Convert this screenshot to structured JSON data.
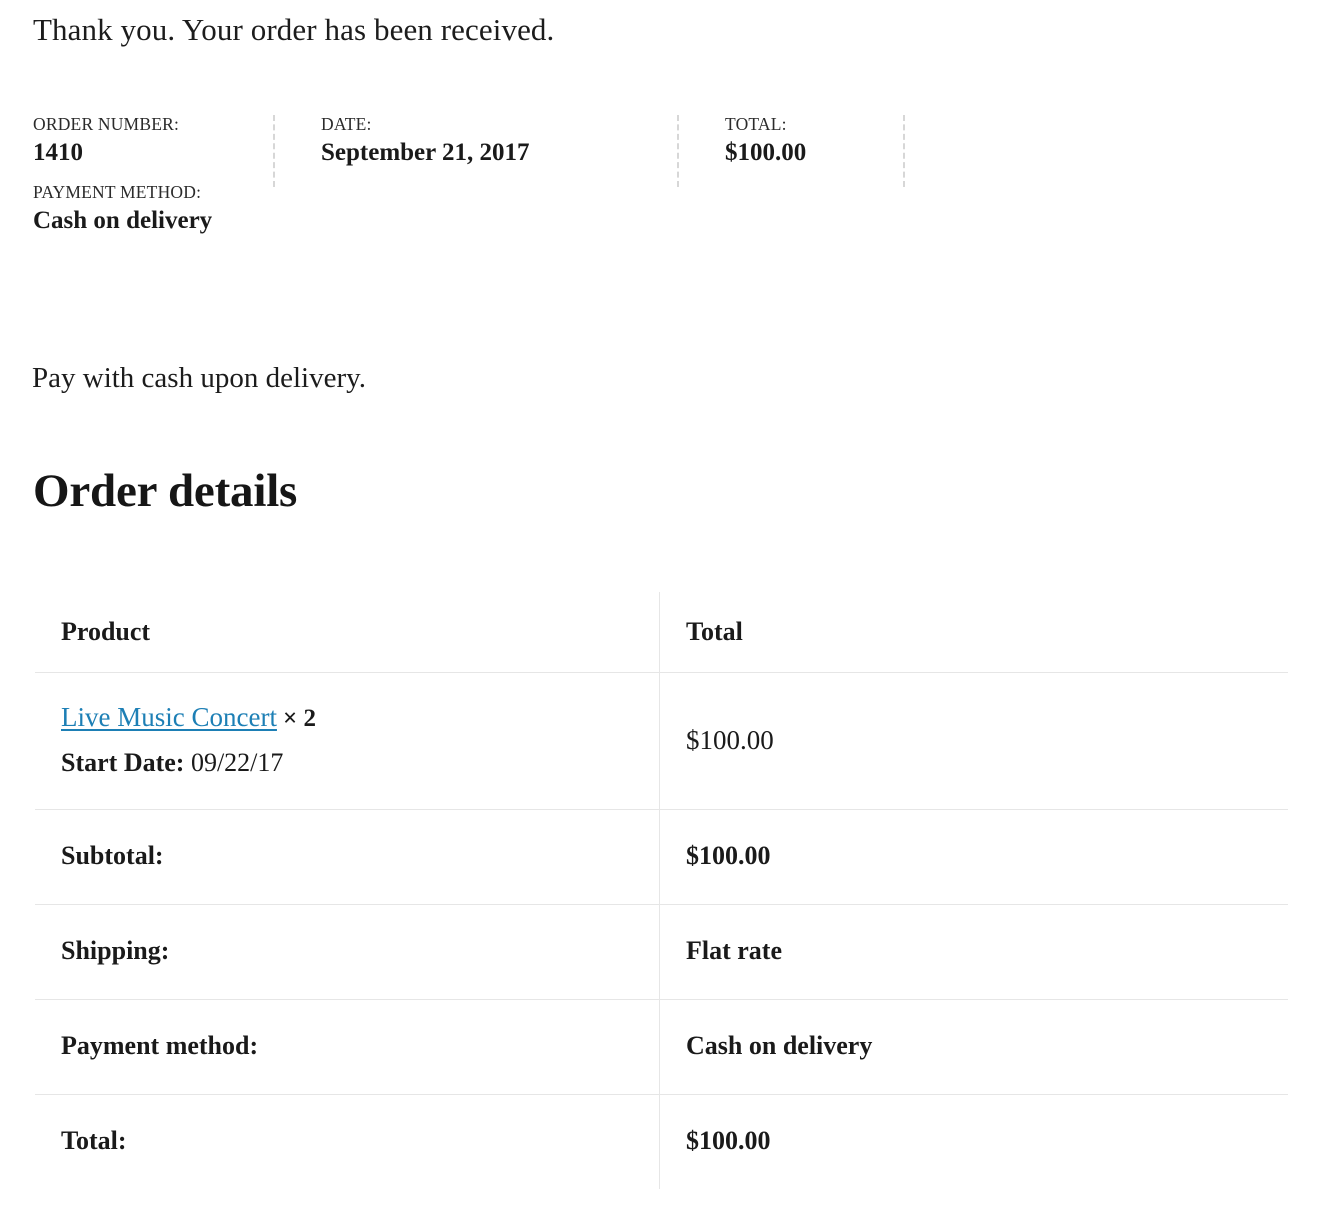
{
  "confirmation": {
    "message": "Thank you. Your order has been received."
  },
  "order_overview": {
    "order_number": {
      "label": "Order number:",
      "value": "1410"
    },
    "date": {
      "label": "Date:",
      "value": "September 21, 2017"
    },
    "total": {
      "label": "Total:",
      "value": "$100.00"
    },
    "payment_method": {
      "label": "Payment method:",
      "value": "Cash on delivery"
    }
  },
  "payment_instruction": "Pay with cash upon delivery.",
  "order_details": {
    "heading": "Order details",
    "columns": [
      "Product",
      "Total"
    ],
    "line_items": [
      {
        "product_name": "Live Music Concert",
        "quantity_separator": "×",
        "quantity": "2",
        "meta_key": "Start Date:",
        "meta_value": "09/22/17",
        "total": "$100.00"
      }
    ],
    "summary": [
      {
        "label": "Subtotal:",
        "value": "$100.00"
      },
      {
        "label": "Shipping:",
        "value": "Flat rate"
      },
      {
        "label": "Payment method:",
        "value": "Cash on delivery"
      },
      {
        "label": "Total:",
        "value": "$100.00"
      }
    ]
  },
  "colors": {
    "link": "#1d7fb5",
    "text": "#1a1a1a",
    "table_border": "#e6e6e6",
    "dashed_divider": "#d7d7d7",
    "background": "#ffffff"
  }
}
